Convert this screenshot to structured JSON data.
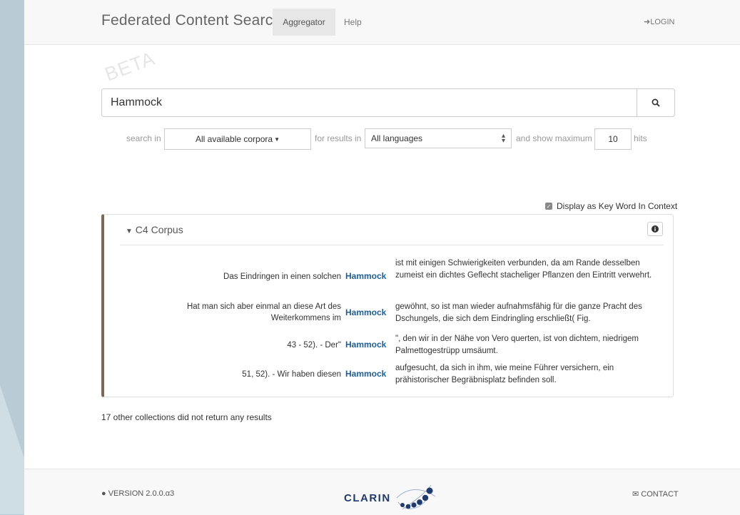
{
  "navbar": {
    "brand": "Federated Content Search",
    "tabs": [
      {
        "label": "Aggregator"
      },
      {
        "label": "Help"
      }
    ],
    "login": "LOGIN"
  },
  "beta": "BETA",
  "search": {
    "value": "Hammock"
  },
  "options": {
    "search_in_label": "search in",
    "corpora_value": "All available corpora",
    "results_in_label": "for results in",
    "language_value": "All languages",
    "show_max_label": "and show maximum",
    "max_hits": "10",
    "hits_label": "hits"
  },
  "kwic_toggle": {
    "label": "Display as Key Word In Context",
    "checked": true
  },
  "panel": {
    "title": "C4 Corpus",
    "results": [
      {
        "left": "Das Eindringen in einen solchen",
        "keyword": "Hammock",
        "right": "ist mit einigen Schwierigkeiten verbunden, da am Rande desselben zumeist ein dichtes Geflecht stacheliger Pflanzen den Eintritt verwehrt."
      },
      {
        "left": "Hat man sich aber einmal an diese Art des Weiterkommens im",
        "keyword": "Hammock",
        "right": "gewöhnt, so ist man wieder aufnahmsfähig für die ganze Pracht des Dschungels, die sich dem Eindringling erschließt( Fig."
      },
      {
        "left": "43 - 52). - Der\"",
        "keyword": "Hammock",
        "right": "\", den wir in der Nähe von Vero querten, ist von dichtem, niedrigem Palmettogestrüpp umsäumt."
      },
      {
        "left": "51, 52). - Wir haben diesen",
        "keyword": "Hammock",
        "right": "aufgesucht, da sich in ihm, wie meine Führer versichern, ein prähistorischer Begräbnisplatz befinden soll."
      }
    ]
  },
  "no_results_text": "17 other collections did not return any results",
  "footer": {
    "version": "VERSION 2.0.0.α3",
    "logo": "CLARIN",
    "contact": "CONTACT"
  }
}
